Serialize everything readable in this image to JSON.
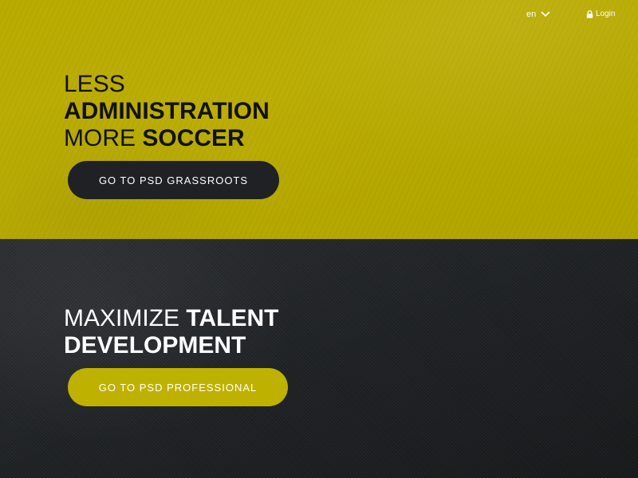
{
  "header": {
    "language": "en",
    "login_label": "Login"
  },
  "grassroots": {
    "line1": "LESS",
    "line2": "ADMINISTRATION",
    "line3_normal": "MORE",
    "line3_bold": "SOCCER",
    "button_label": "GO TO PSD GRASSROOTS"
  },
  "professional": {
    "line1_normal": "MAXIMIZE",
    "line1_bold": "TALENT",
    "line2": "DEVELOPMENT",
    "button_label": "GO TO PSD PROFESSIONAL"
  },
  "colors": {
    "brand_yellow": "#bfb100",
    "dark": "#1f2124"
  }
}
